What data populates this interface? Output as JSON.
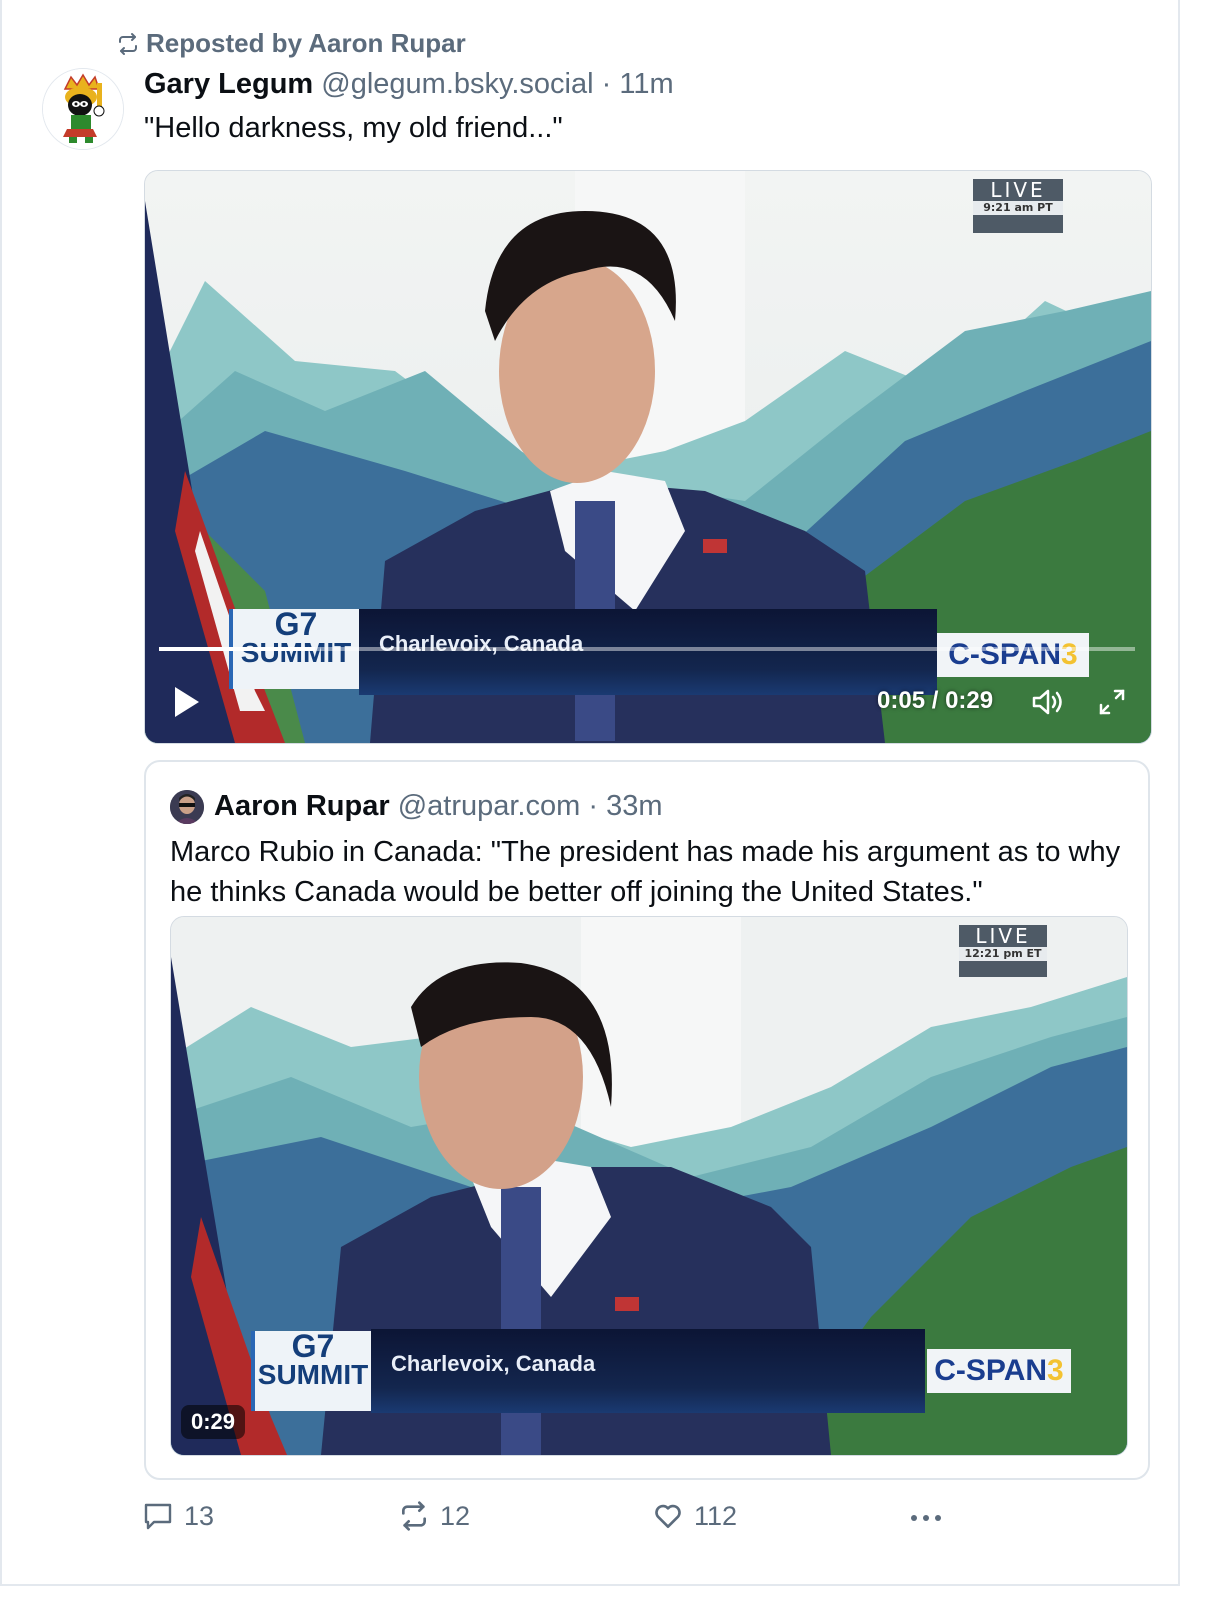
{
  "repost": {
    "label": "Reposted by Aaron Rupar"
  },
  "post": {
    "author_name": "Gary Legum",
    "handle": "@glegum.bsky.social",
    "separator": "·",
    "time": "11m",
    "text": "\"Hello darkness, my old friend...\""
  },
  "main_video": {
    "live_label": "LIVE",
    "live_time": "9:21 am PT",
    "g7_line1": "G7",
    "g7_line2": "SUMMIT",
    "location": "Charlevoix, Canada",
    "network": "C-SPAN",
    "network_num": "3",
    "current_time": "0:05",
    "time_sep": "/",
    "duration": "0:29",
    "progress": 0.16
  },
  "quote": {
    "author_name": "Aaron Rupar",
    "handle": "@atrupar.com",
    "separator": "·",
    "time": "33m",
    "text": "Marco Rubio in Canada: \"The president has made his argument as to why he thinks Canada would be better off joining the United States.\"",
    "video": {
      "live_label": "LIVE",
      "live_time": "12:21 pm ET",
      "g7_line1": "G7",
      "g7_line2": "SUMMIT",
      "location": "Charlevoix, Canada",
      "network": "C-SPAN",
      "network_num": "3",
      "duration": "0:29"
    }
  },
  "actions": {
    "replies": "13",
    "reposts": "12",
    "likes": "112"
  },
  "colors": {
    "muted_text": "#5b6b7c",
    "border": "#dfe5eb",
    "lower_third": "#0c1535",
    "cspan_blue": "#1a3d8f"
  }
}
